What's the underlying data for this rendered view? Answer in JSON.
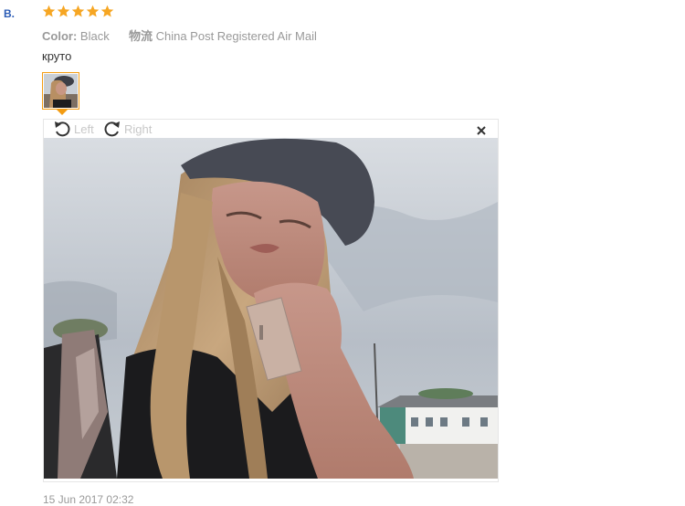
{
  "review": {
    "reviewer": "B.",
    "rating": 5,
    "color_label": "Color:",
    "color_value": "Black",
    "shipping_label": "物流",
    "shipping_value": "China Post Registered Air Mail",
    "text": "круто",
    "date": "15 Jun 2017 02:32"
  },
  "viewer": {
    "rotate_left_label": "Left",
    "rotate_right_label": "Right",
    "close_icon": "close-icon",
    "photo_alt": "review photo"
  },
  "colors": {
    "star": "#f6a623",
    "thumb_border": "#f39c12",
    "reviewer": "#2a5bb5"
  }
}
